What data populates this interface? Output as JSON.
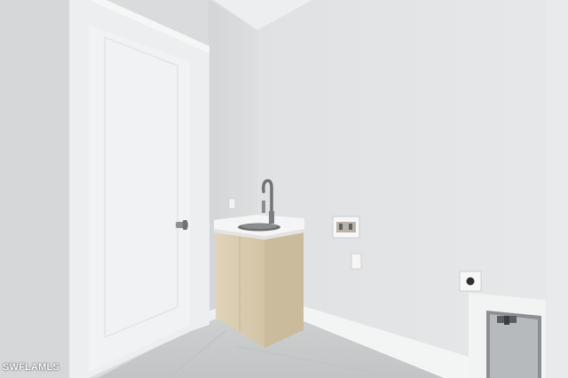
{
  "photo": {
    "subject": "laundry-room",
    "watermark": "SWFLAMLS"
  },
  "colors": {
    "wall_left": "#d8dadc",
    "wall_center": "#dcdee0",
    "wall_right": "#e3e5e6",
    "ceiling": "#e9ebec",
    "floor": "#c9cbcc",
    "door": "#f1f2f3",
    "cabinet": "#d8c9ad",
    "countertop": "#f4f4f4"
  }
}
